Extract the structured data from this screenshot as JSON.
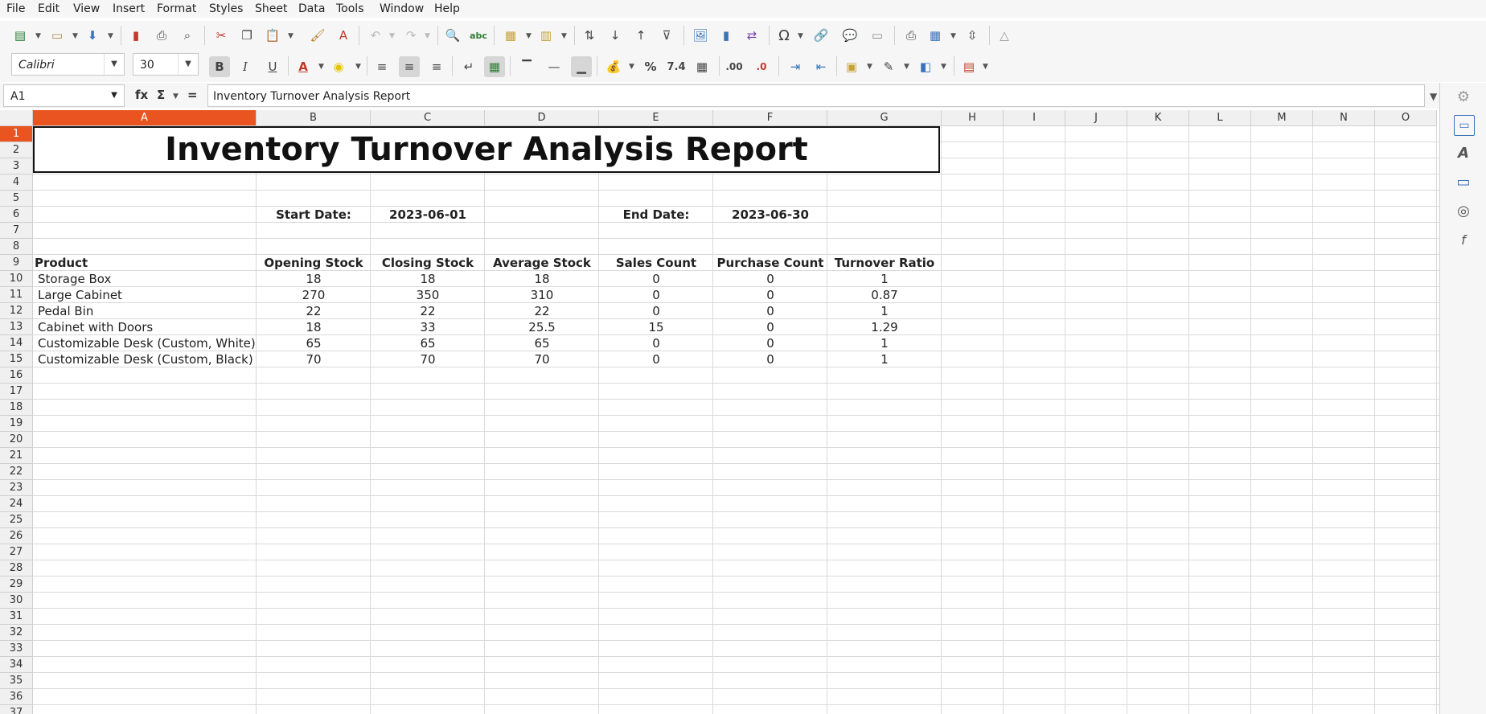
{
  "menu": [
    "File",
    "Edit",
    "View",
    "Insert",
    "Format",
    "Styles",
    "Sheet",
    "Data",
    "Tools",
    "Window",
    "Help"
  ],
  "font": {
    "name": "Calibri",
    "size": "30"
  },
  "name_box": "A1",
  "formula_text": "Inventory Turnover Analysis Report",
  "fx_label": "fx",
  "sum_label": "Σ",
  "eq_label": "=",
  "columns": [
    "A",
    "B",
    "C",
    "D",
    "E",
    "F",
    "G",
    "H",
    "I",
    "J",
    "K",
    "L",
    "M",
    "N",
    "O"
  ],
  "rows": [
    "1",
    "2",
    "3",
    "4",
    "5",
    "6",
    "7",
    "8",
    "9",
    "10",
    "11",
    "12",
    "13",
    "14",
    "15",
    "16",
    "17",
    "18",
    "19",
    "20",
    "21",
    "22",
    "23",
    "24",
    "25",
    "26",
    "27",
    "28",
    "29",
    "30",
    "31",
    "32",
    "33",
    "34",
    "35",
    "36",
    "37"
  ],
  "sheet": {
    "title": "Inventory Turnover Analysis Report",
    "start_date_label": "Start Date:",
    "start_date": "2023-06-01",
    "end_date_label": "End Date:",
    "end_date": "2023-06-30",
    "headers": [
      "Product",
      "Opening Stock",
      "Closing Stock",
      "Average Stock",
      "Sales Count",
      "Purchase Count",
      "Turnover Ratio"
    ],
    "data": [
      [
        "Storage Box",
        "18",
        "18",
        "18",
        "0",
        "0",
        "1"
      ],
      [
        "Large Cabinet",
        "270",
        "350",
        "310",
        "0",
        "0",
        "0.87"
      ],
      [
        "Pedal Bin",
        "22",
        "22",
        "22",
        "0",
        "0",
        "1"
      ],
      [
        "Cabinet with Doors",
        "18",
        "33",
        "25.5",
        "15",
        "0",
        "1.29"
      ],
      [
        "Customizable Desk (Custom, White)",
        "65",
        "65",
        "65",
        "0",
        "0",
        "1"
      ],
      [
        "Customizable Desk (Custom, Black)",
        "70",
        "70",
        "70",
        "0",
        "0",
        "1"
      ]
    ]
  },
  "toolbar_icons": [
    "new-icon",
    "open-icon",
    "save-icon",
    "export-pdf-icon",
    "print-icon",
    "print-preview-icon",
    "cut-icon",
    "copy-icon",
    "paste-icon",
    "clone-formatting-icon",
    "clear-formatting-icon",
    "undo-icon",
    "redo-icon",
    "find-replace-icon",
    "spellcheck-icon",
    "row-icon",
    "column-icon",
    "sort-icon",
    "sort-ascending-icon",
    "sort-descending-icon",
    "autofilter-icon",
    "insert-image-icon",
    "insert-chart-icon",
    "pivot-table-icon",
    "special-character-icon",
    "hyperlink-icon",
    "comment-icon",
    "header-footer-icon",
    "define-print-area-icon",
    "freeze-rows-icon",
    "split-window-icon",
    "show-draw-functions-icon"
  ],
  "sidebar_icons": [
    "properties-gear-icon",
    "page-icon",
    "styles-icon",
    "gallery-icon",
    "navigator-icon",
    "functions-icon"
  ]
}
